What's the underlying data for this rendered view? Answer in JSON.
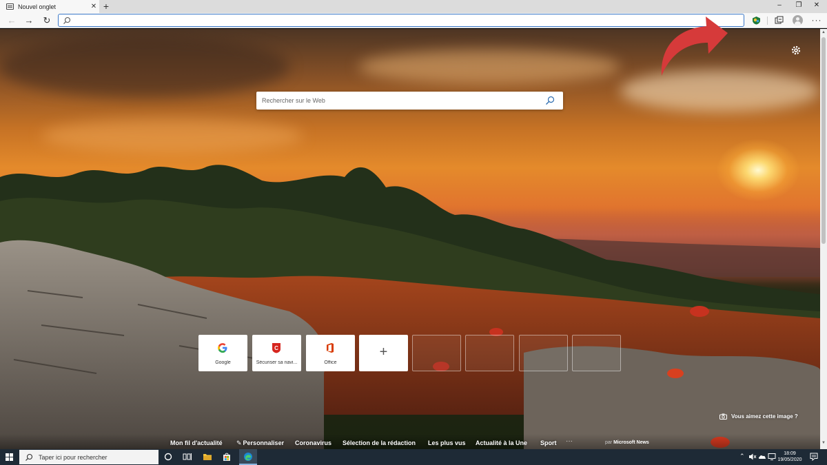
{
  "browser": {
    "tab": {
      "title": "Nouvel onglet",
      "close": "✕"
    },
    "new_tab": "+",
    "window_controls": {
      "minimize": "–",
      "restore": "❐",
      "close": "✕"
    },
    "nav": {
      "back": "←",
      "forward": "→",
      "refresh": "↻"
    },
    "address": {
      "value": "",
      "placeholder": ""
    },
    "more": "···"
  },
  "page": {
    "search": {
      "placeholder": "Rechercher sur le Web"
    },
    "tiles": [
      {
        "label": "Google",
        "icon": "google-icon"
      },
      {
        "label": "Sécuriser sa navi...",
        "icon": "security-shield-icon"
      },
      {
        "label": "Office",
        "icon": "office-icon"
      },
      {
        "label": "+",
        "icon": "add-icon"
      }
    ],
    "like_image": "Vous aimez cette image ?",
    "news": {
      "items": [
        "Mon fil d'actualité",
        "Personnaliser",
        "Coronavirus",
        "Sélection de la rédaction",
        "Les plus vus",
        "Actualité à la Une",
        "Sport"
      ],
      "more": "···",
      "powered_prefix": "par",
      "powered_brand": "Microsoft News"
    }
  },
  "taskbar": {
    "search_placeholder": "Taper ici pour rechercher",
    "time": "18:09",
    "date": "19/05/2020"
  },
  "colors": {
    "accent": "#3b78c8",
    "annotation_arrow": "#d63a3a",
    "taskbar": "#1e2a36",
    "office": "#d83b01"
  }
}
